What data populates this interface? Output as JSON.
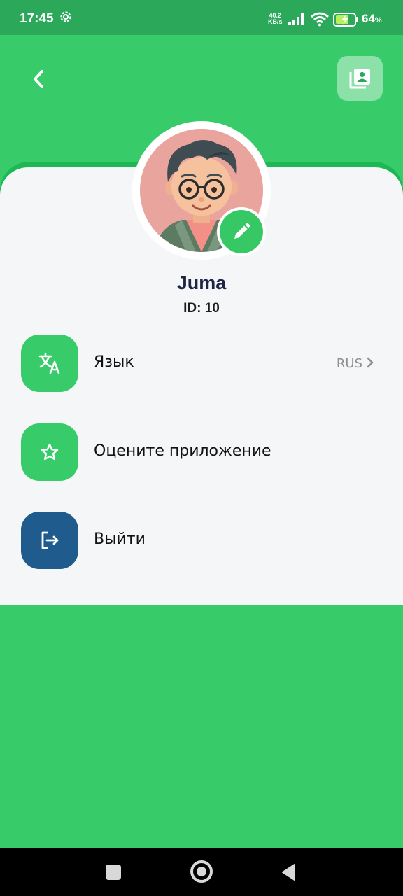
{
  "status_bar": {
    "time": "17:45",
    "net_speed_value": "40.2",
    "net_speed_unit": "KB/s",
    "battery_percent": "64",
    "battery_unit": "%"
  },
  "profile": {
    "name": "Juma",
    "id_label": "ID: 10"
  },
  "menu": {
    "language": {
      "label": "Язык",
      "value": "RUS",
      "icon": "translate-icon"
    },
    "rate": {
      "label": "Оцените приложение",
      "icon": "star-icon"
    },
    "logout": {
      "label": "Выйти",
      "icon": "logout-icon"
    }
  },
  "colors": {
    "primary": "#38cb6a",
    "status_bar": "#2ba85a",
    "card_background": "#f5f6f8",
    "logout_accent": "#1f5b8c",
    "nav_bar": "#000000"
  }
}
